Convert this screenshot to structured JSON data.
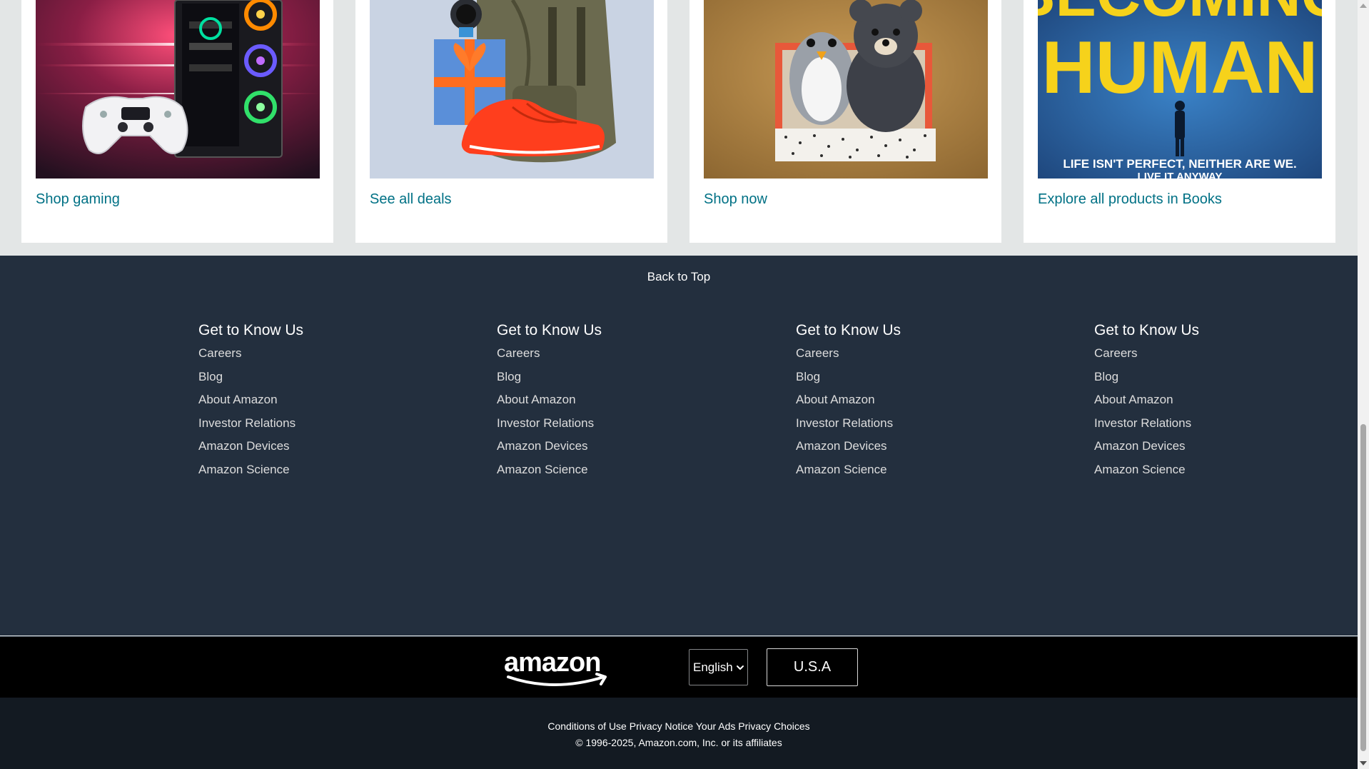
{
  "cards": [
    {
      "image": "gaming-pc-controller-image",
      "link": "Shop gaming"
    },
    {
      "image": "deals-backpack-sneaker-image",
      "link": "See all deals"
    },
    {
      "image": "plush-toys-image",
      "link": "Shop now"
    },
    {
      "image": "book-cover-image",
      "link": "Explore all products in Books",
      "book_title_top": "BECOMING",
      "book_title": "HUMAN",
      "book_tagline": "LIFE ISN'T PERFECT, NEITHER ARE WE.",
      "book_tagline_2": "LIVE IT ANYWAY"
    }
  ],
  "back_to_top": "Back to Top",
  "footer_columns": [
    {
      "heading": "Get to Know Us",
      "links": [
        "Careers",
        "Blog",
        "About Amazon",
        "Investor Relations",
        "Amazon Devices",
        "Amazon Science"
      ]
    },
    {
      "heading": "Get to Know Us",
      "links": [
        "Careers",
        "Blog",
        "About Amazon",
        "Investor Relations",
        "Amazon Devices",
        "Amazon Science"
      ]
    },
    {
      "heading": "Get to Know Us",
      "links": [
        "Careers",
        "Blog",
        "About Amazon",
        "Investor Relations",
        "Amazon Devices",
        "Amazon Science"
      ]
    },
    {
      "heading": "Get to Know Us",
      "links": [
        "Careers",
        "Blog",
        "About Amazon",
        "Investor Relations",
        "Amazon Devices",
        "Amazon Science"
      ]
    }
  ],
  "logo_text": "amazon",
  "language": {
    "selected": "English",
    "icon": "chevron-down-icon"
  },
  "country": "U.S.A",
  "legal_links": [
    "Conditions of Use",
    "Privacy Notice",
    "Your Ads Privacy Choices"
  ],
  "copyright": "© 1996-2025, Amazon.com, Inc. or its affiliates",
  "colors": {
    "link_teal": "#007185",
    "footer_bg": "#232f3e",
    "logo_strip_bg": "#000000",
    "legal_bg": "#131a22",
    "page_bg": "#e3e6e6",
    "amazon_orange": "#ff9900"
  }
}
